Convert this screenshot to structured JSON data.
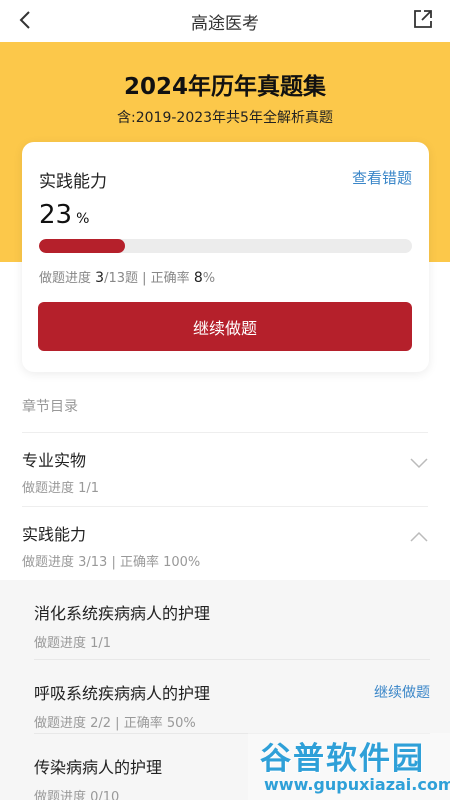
{
  "header": {
    "title": "高途医考",
    "back_icon": "chevron-left-icon",
    "share_icon": "share-icon"
  },
  "banner": {
    "title": "2024年历年真题集",
    "subtitle": "含:2019-2023年共5年全解析真题",
    "color": "#fcc84a"
  },
  "card": {
    "title": "实践能力",
    "review_link": "查看错题",
    "percent": "23",
    "percent_unit": "%",
    "progress_fraction": 0.23,
    "progress_label": "做题进度",
    "progress_done": "3",
    "progress_total": "/13题",
    "separator": " | ",
    "accuracy_label": "正确率",
    "accuracy_value": "8",
    "accuracy_unit": "%",
    "button_label": "继续做题",
    "accent_color": "#b5202b",
    "link_color": "#3a86c8"
  },
  "toc": {
    "label": "章节目录",
    "chapters": [
      {
        "name": "专业实物",
        "progress": "做题进度 1/1",
        "expanded": false
      },
      {
        "name": "实践能力",
        "progress": "做题进度 3/13 | 正确率 100%",
        "expanded": true
      }
    ],
    "sections": [
      {
        "name": "消化系统疾病病人的护理",
        "progress": "做题进度 1/1",
        "action": ""
      },
      {
        "name": "呼吸系统疾病病人的护理",
        "progress": "做题进度 2/2 | 正确率 50%",
        "action": "继续做题"
      },
      {
        "name": "传染病病人的护理",
        "progress": "做题进度 0/10",
        "action": ""
      }
    ]
  },
  "watermark": {
    "line1": "谷普软件园",
    "line2": "www.gupuxiazai.com"
  }
}
